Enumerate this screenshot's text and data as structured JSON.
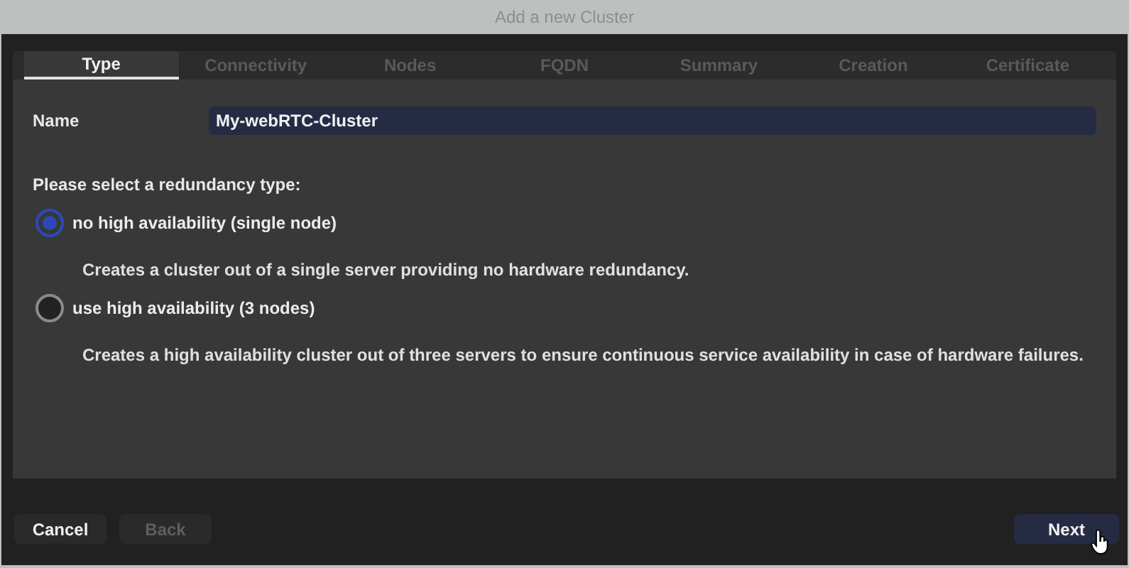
{
  "window": {
    "title": "Add a new Cluster"
  },
  "tabs": [
    {
      "label": "Type",
      "selected": true
    },
    {
      "label": "Connectivity",
      "selected": false
    },
    {
      "label": "Nodes",
      "selected": false
    },
    {
      "label": "FQDN",
      "selected": false
    },
    {
      "label": "Summary",
      "selected": false
    },
    {
      "label": "Creation",
      "selected": false
    },
    {
      "label": "Certificate",
      "selected": false
    }
  ],
  "name_field": {
    "label": "Name",
    "value": "My-webRTC-Cluster"
  },
  "redundancy": {
    "prompt": "Please select a redundancy type:",
    "options": [
      {
        "label": "no high availability (single node)",
        "selected": true,
        "description": "Creates a cluster out of a single server providing no hardware redundancy."
      },
      {
        "label": "use high availability (3 nodes)",
        "selected": false,
        "description": "Creates a high availability cluster out of three servers to ensure continuous service availability in case of hardware failures."
      }
    ]
  },
  "buttons": [
    {
      "label": "Cancel",
      "disabled": false,
      "kind": "secondary"
    },
    {
      "label": "Back",
      "disabled": true,
      "kind": "secondary"
    },
    {
      "label": "Next",
      "disabled": false,
      "kind": "primary"
    }
  ]
}
